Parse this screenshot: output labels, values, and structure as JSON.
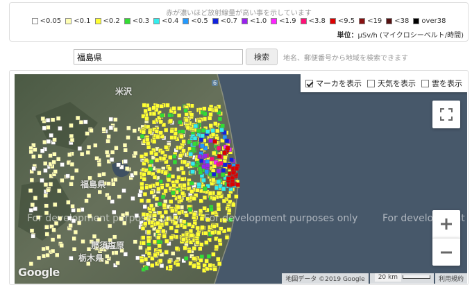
{
  "legend": {
    "hint": "赤が濃いほど放射線量が高い事を示しています",
    "items": [
      {
        "label": "<0.05",
        "color": "#ffffff"
      },
      {
        "label": "<0.1",
        "color": "#ffffb4"
      },
      {
        "label": "<0.2",
        "color": "#ffff33"
      },
      {
        "label": "<0.3",
        "color": "#33dd33"
      },
      {
        "label": "<0.4",
        "color": "#33eeee"
      },
      {
        "label": "<0.5",
        "color": "#2299ff"
      },
      {
        "label": "<0.7",
        "color": "#1122dd"
      },
      {
        "label": "<1.0",
        "color": "#9922ee"
      },
      {
        "label": "<1.9",
        "color": "#ff22ff"
      },
      {
        "label": "<3.8",
        "color": "#ff1177"
      },
      {
        "label": "<9.5",
        "color": "#dd0000"
      },
      {
        "label": "<19",
        "color": "#881111"
      },
      {
        "label": "<38",
        "color": "#551111"
      },
      {
        "label": "over38",
        "color": "#000000"
      }
    ],
    "unit_label": "単位：",
    "unit_value": "μSv/h (マイクロシーベルト/時間)"
  },
  "search": {
    "value": "福島県",
    "button_label": "検索",
    "hint": "地名、郵便番号から地域を検索できます"
  },
  "map": {
    "toggles": [
      {
        "label": "マーカを表示",
        "checked": true
      },
      {
        "label": "天気を表示",
        "checked": false
      },
      {
        "label": "雲を表示",
        "checked": false
      }
    ],
    "watermark": "For development purposes only",
    "places": [
      "米沢",
      "福島県",
      "那須塩原",
      "栃木県"
    ],
    "route_number": "6",
    "google_logo": "Google",
    "attribution": {
      "data": "地図データ ©2019 Google",
      "scale": "20 km",
      "terms": "利用規約"
    }
  }
}
